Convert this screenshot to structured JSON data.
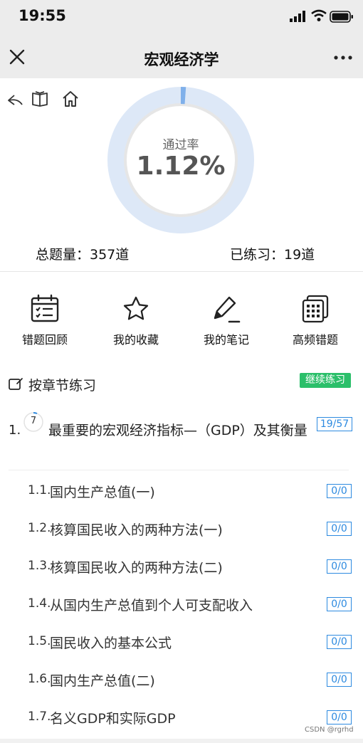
{
  "status_bar": {
    "time": "19:55"
  },
  "nav": {
    "title": "宏观经济学"
  },
  "summary": {
    "pass_rate_label": "通过率",
    "pass_rate_value": "1.12%",
    "pass_rate_fraction": 0.0112,
    "total_label": "总题量：357道",
    "practiced_label": "已练习：19道"
  },
  "actions": [
    {
      "label": "错题回顾",
      "icon": "calendar-list-icon"
    },
    {
      "label": "我的收藏",
      "icon": "star-icon"
    },
    {
      "label": "我的笔记",
      "icon": "pen-icon"
    },
    {
      "label": "高频错题",
      "icon": "grid-stack-icon"
    }
  ],
  "section": {
    "title": "按章节练习",
    "continue_label": "继续练习"
  },
  "chapter": {
    "number": "1.",
    "circle_value": "7",
    "title": "最重要的宏观经济指标—（GDP）及其衡量",
    "progress": "19/57"
  },
  "lessons": [
    {
      "number": "1.1.",
      "title": "国内生产总值(一)",
      "progress": "0/0"
    },
    {
      "number": "1.2.",
      "title": "核算国民收入的两种方法(一)",
      "progress": "0/0"
    },
    {
      "number": "1.3.",
      "title": "核算国民收入的两种方法(二)",
      "progress": "0/0"
    },
    {
      "number": "1.4.",
      "title": "从国内生产总值到个人可支配收入",
      "progress": "0/0"
    },
    {
      "number": "1.5.",
      "title": "国民收入的基本公式",
      "progress": "0/0"
    },
    {
      "number": "1.6.",
      "title": "国内生产总值(二)",
      "progress": "0/0"
    },
    {
      "number": "1.7.",
      "title": "名义GDP和实际GDP",
      "progress": "0/0"
    }
  ],
  "watermark": "CSDN @rgrhd",
  "colors": {
    "accent_green": "#2bbf6a",
    "accent_blue": "#2d8ae0",
    "ring": "#d9e6f7"
  }
}
